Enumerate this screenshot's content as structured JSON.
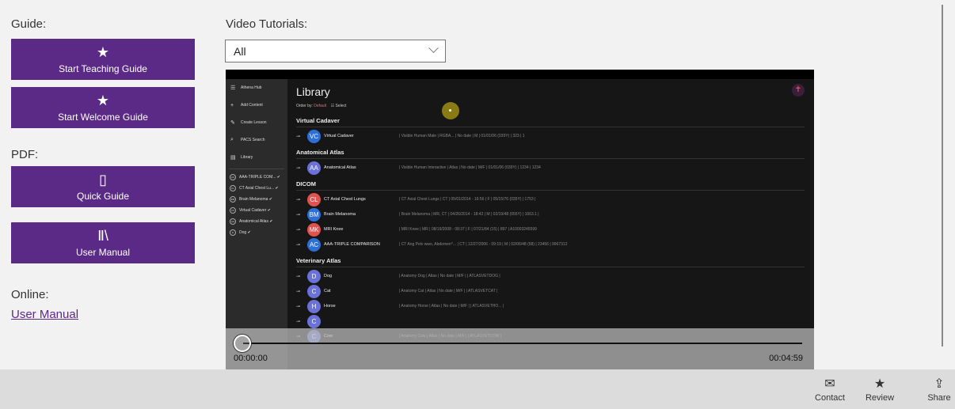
{
  "guide": {
    "label": "Guide:",
    "buttons": [
      {
        "icon": "star-icon",
        "glyph": "★",
        "label": "Start Teaching Guide"
      },
      {
        "icon": "star-icon",
        "glyph": "★",
        "label": "Start Welcome Guide"
      }
    ]
  },
  "pdf": {
    "label": "PDF:",
    "buttons": [
      {
        "icon": "phone-icon",
        "glyph": "▯",
        "label": "Quick Guide"
      },
      {
        "icon": "library-icon",
        "glyph": "Ⅱ\\",
        "label": "User Manual"
      }
    ]
  },
  "online": {
    "label": "Online:",
    "link": "User Manual"
  },
  "tutorials": {
    "label": "Video Tutorials:",
    "selected": "All"
  },
  "video": {
    "sidebar": {
      "items": [
        {
          "glyph": "☰",
          "label": "Athena Hub"
        },
        {
          "glyph": "+",
          "label": "Add Content"
        },
        {
          "glyph": "✎",
          "label": "Create Lesson"
        },
        {
          "glyph": "⌕",
          "label": "PACS Search"
        },
        {
          "glyph": "▤",
          "label": "Library"
        }
      ],
      "library": [
        {
          "ab": "AC",
          "label": "AAA-TRIPLE COM... ✔"
        },
        {
          "ab": "CL",
          "label": "CT Axial Chest Lu... ✔"
        },
        {
          "ab": "BM",
          "label": "Brain Melanoma ✔"
        },
        {
          "ab": "VC",
          "label": "Virtual Cadaver ✔"
        },
        {
          "ab": "AA",
          "label": "Anatomical Atlas ✔"
        },
        {
          "ab": "D",
          "label": "Dog ✔"
        }
      ]
    },
    "title": "Library",
    "order_by": "Order by:",
    "order_value": "Default",
    "select": "Select",
    "sections": [
      {
        "title": "Virtual Cadaver",
        "rows": [
          {
            "ab": "VC",
            "color": "#2d6fd6",
            "name": "Virtual Cadaver",
            "meta": "|   Visible Human Male   |  RGBA...  |   No date   |  M  |  01/01/06 (039Y)  |   323   |   1"
          }
        ]
      },
      {
        "title": "Anatomical Atlas",
        "rows": [
          {
            "ab": "AA",
            "color": "#6a72d8",
            "name": "Anatomical Atlas",
            "meta": "|   Visible Human Interactive   |  Atlas  |   No date   |  M/F  |  01/01/06 (039Y)  |   1234   |   1234"
          }
        ]
      },
      {
        "title": "DICOM",
        "rows": [
          {
            "ab": "CL",
            "color": "#e0524f",
            "name": "CT Axial Chest Lungs",
            "meta": "|   CT Axial Chest Lungs   |  CT  |  05/01/2014 - 16:56  |  F  |  05/15/76 (035Y)  |   1753   |"
          },
          {
            "ab": "BM",
            "color": "#2d6fd6",
            "name": "Brain Melanoma",
            "meta": "|   Brain Melanoma   |  MR, CT  |  04/26/2014 - 18:42  |  M  |  02/19/48 (055Y)  |   1663.1   |"
          },
          {
            "ab": "MK",
            "color": "#e0524f",
            "name": "MRI Knee",
            "meta": "|   MRI Knee   |  MR  |  08/19/2008 - 08:37  |  F  |  07/21/84 (15)  |   897   |  A10003245599"
          },
          {
            "ab": "AC",
            "color": "#2d6fd6",
            "name": "AAA-TRIPLE COMPARISON",
            "meta": "|  CT Ang Pelv wwo, Abdomen^...  |  CT  |  12/27/2006 - 09:19  |  M  |  02/06/48 (58)  |   23456   |  9967312"
          }
        ]
      },
      {
        "title": "Veterinary Atlas",
        "rows": [
          {
            "ab": "D",
            "color": "#6a72d8",
            "name": "Dog",
            "meta": "|   Anatomy Dog   |  Atlas  |   No date   |  M/F  |     |   ATLASVETDOG  |"
          },
          {
            "ab": "C",
            "color": "#6a72d8",
            "name": "Cat",
            "meta": "|   Anatomy Cat   |  Atlas  |   No date   |  M/F  |     |   ATLASVETCAT  |"
          },
          {
            "ab": "H",
            "color": "#6a72d8",
            "name": "Horse",
            "meta": "|   Anatomy Horse   |  Atlas  |   No date   |  M/F  |     |   ATLASVETHO...  |"
          },
          {
            "ab": "C",
            "color": "#6a72d8",
            "name": "",
            "meta": ""
          },
          {
            "ab": "C",
            "color": "#6a72d8",
            "name": "Cow",
            "meta": "|   Anatomy Cow   |  Atlas  |   No date   |  M/F  |     |   ATLASVETCOW  |"
          }
        ]
      }
    ],
    "time_current": "00:00:00",
    "time_total": "00:04:59",
    "progress": 0
  },
  "appbar": [
    {
      "icon": "mail-icon",
      "glyph": "✉",
      "label": "Contact"
    },
    {
      "icon": "star-icon",
      "glyph": "★",
      "label": "Review"
    },
    {
      "icon": "share-icon",
      "glyph": "⇪",
      "label": "Share"
    }
  ],
  "colors": {
    "accent": "#5b2a86",
    "appbar": "#dcdcdc",
    "background": "#f2f2f2"
  }
}
